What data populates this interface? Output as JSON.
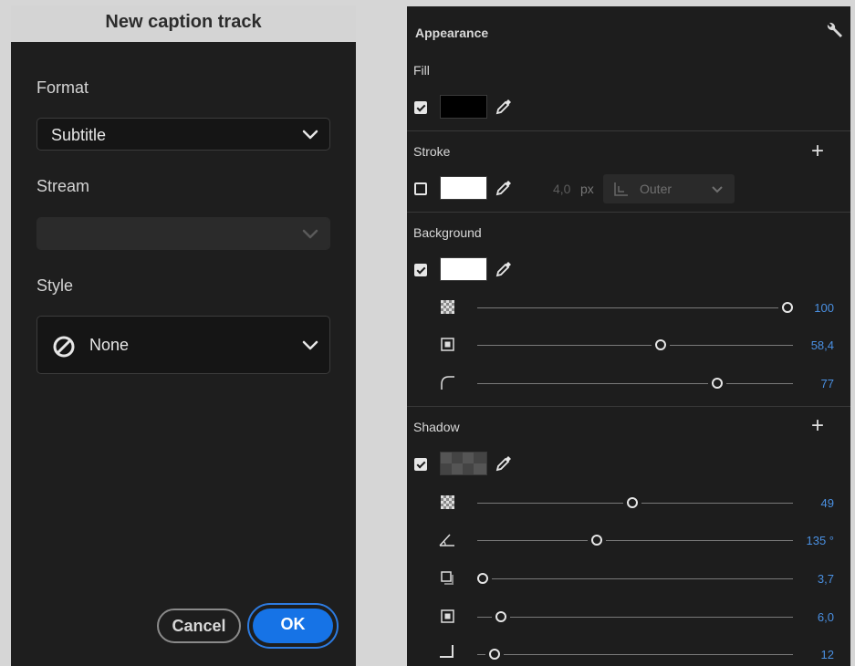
{
  "dialog": {
    "title": "New caption track",
    "format": {
      "label": "Format",
      "value": "Subtitle"
    },
    "stream": {
      "label": "Stream",
      "value": ""
    },
    "style": {
      "label": "Style",
      "value": "None"
    },
    "cancel_label": "Cancel",
    "ok_label": "OK"
  },
  "panel": {
    "title": "Appearance",
    "fill": {
      "label": "Fill",
      "checked": true,
      "color": "#000000"
    },
    "stroke": {
      "label": "Stroke",
      "checked": false,
      "color": "#ffffff",
      "size": "4,0",
      "unit": "px",
      "position": "Outer"
    },
    "background": {
      "label": "Background",
      "checked": true,
      "color": "#ffffff",
      "opacity": {
        "value_text": "100",
        "level": 1.0
      },
      "size": {
        "value_text": "58,4",
        "level": 0.584
      },
      "corner_radius": {
        "value_text": "77",
        "level": 0.77
      }
    },
    "shadow": {
      "label": "Shadow",
      "checked": true,
      "opacity": {
        "value_text": "49",
        "level": 0.49
      },
      "angle": {
        "value_text": "135 °",
        "level": 0.375
      },
      "distance": {
        "value_text": "3,7",
        "level": 0.0
      },
      "size": {
        "value_text": "6,0",
        "level": 0.06
      },
      "blur": {
        "value_text": "12",
        "level": 0.04
      }
    }
  },
  "colors": {
    "accent": "#1673e6",
    "value_blue": "#4a90e2",
    "panel_bg": "#1d1d1d",
    "dialog_bg": "#1e1e1e"
  },
  "icons": [
    "chevron-down-icon",
    "none-icon",
    "wrench-icon",
    "eyedropper-icon",
    "plus-icon",
    "opacity-icon",
    "size-icon",
    "corner-radius-icon",
    "angle-icon",
    "distance-icon",
    "blur-icon",
    "stroke-position-icon"
  ]
}
